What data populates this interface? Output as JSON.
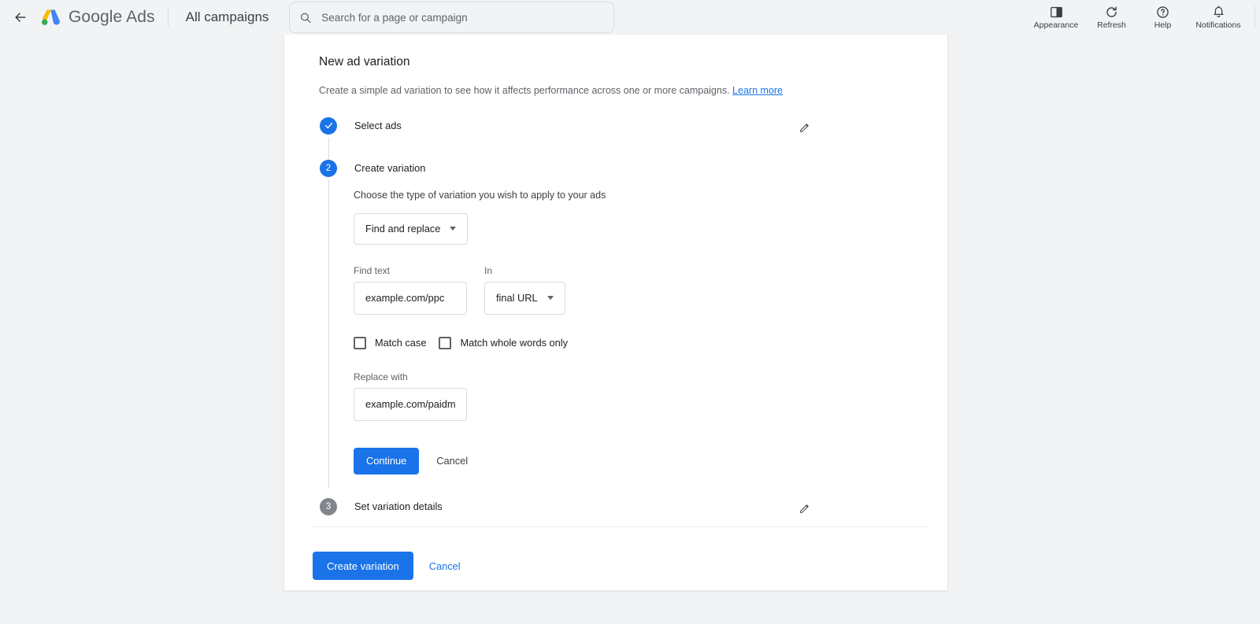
{
  "topbar": {
    "back_icon": "arrow-left-icon",
    "brand_google": "Google",
    "brand_ads": "Ads",
    "account_name": "All campaigns",
    "search": {
      "icon": "search-icon",
      "value": "",
      "placeholder": "Search for a page or campaign"
    },
    "actions": [
      {
        "label": "Appearance",
        "icon": "appearance-icon"
      },
      {
        "label": "Refresh",
        "icon": "refresh-icon"
      },
      {
        "label": "Help",
        "icon": "help-icon"
      },
      {
        "label": "Notifications",
        "icon": "bell-icon"
      }
    ]
  },
  "card": {
    "title": "New ad variation",
    "description": "Create a simple ad variation to see how it affects performance across one or more campaigns.",
    "learn_more": "Learn more",
    "steps": [
      {
        "number": "1",
        "state": "done",
        "badge_glyph": "✓",
        "title": "Select ads",
        "edit_icon": "edit-pencil-icon"
      },
      {
        "number": "2",
        "state": "active",
        "badge_glyph": "2",
        "title": "Create variation"
      },
      {
        "number": "3",
        "state": "inactive",
        "badge_glyph": "3",
        "title": "Set variation details",
        "edit_icon": "edit-pencil-icon"
      }
    ],
    "variation_form": {
      "helper_text": "Choose the type of variation you wish to apply to your ads",
      "type_dropdown": {
        "value": "Find and replace",
        "caret_icon": "chevron-down-icon"
      },
      "find_text": {
        "label": "Find text",
        "value": "example.com/ppc",
        "placeholder": ""
      },
      "in_field": {
        "label": "In",
        "value": "final URL",
        "caret_icon": "chevron-down-icon"
      },
      "match_case": {
        "label": "Match case",
        "checked": false
      },
      "match_whole_words": {
        "label": "Match whole words only",
        "checked": false
      },
      "replace_with": {
        "label": "Replace with",
        "value": "example.com/paidmedia",
        "placeholder": ""
      },
      "continue_label": "Continue",
      "cancel_label": "Cancel"
    },
    "footer": {
      "create_label": "Create variation",
      "cancel_label": "Cancel"
    }
  },
  "colors": {
    "accent_blue": "#1a73e8",
    "page_bg": "#f1f3f4",
    "card_bg": "#ffffff",
    "inactive_grey": "#80868b",
    "border": "#dadce0"
  }
}
